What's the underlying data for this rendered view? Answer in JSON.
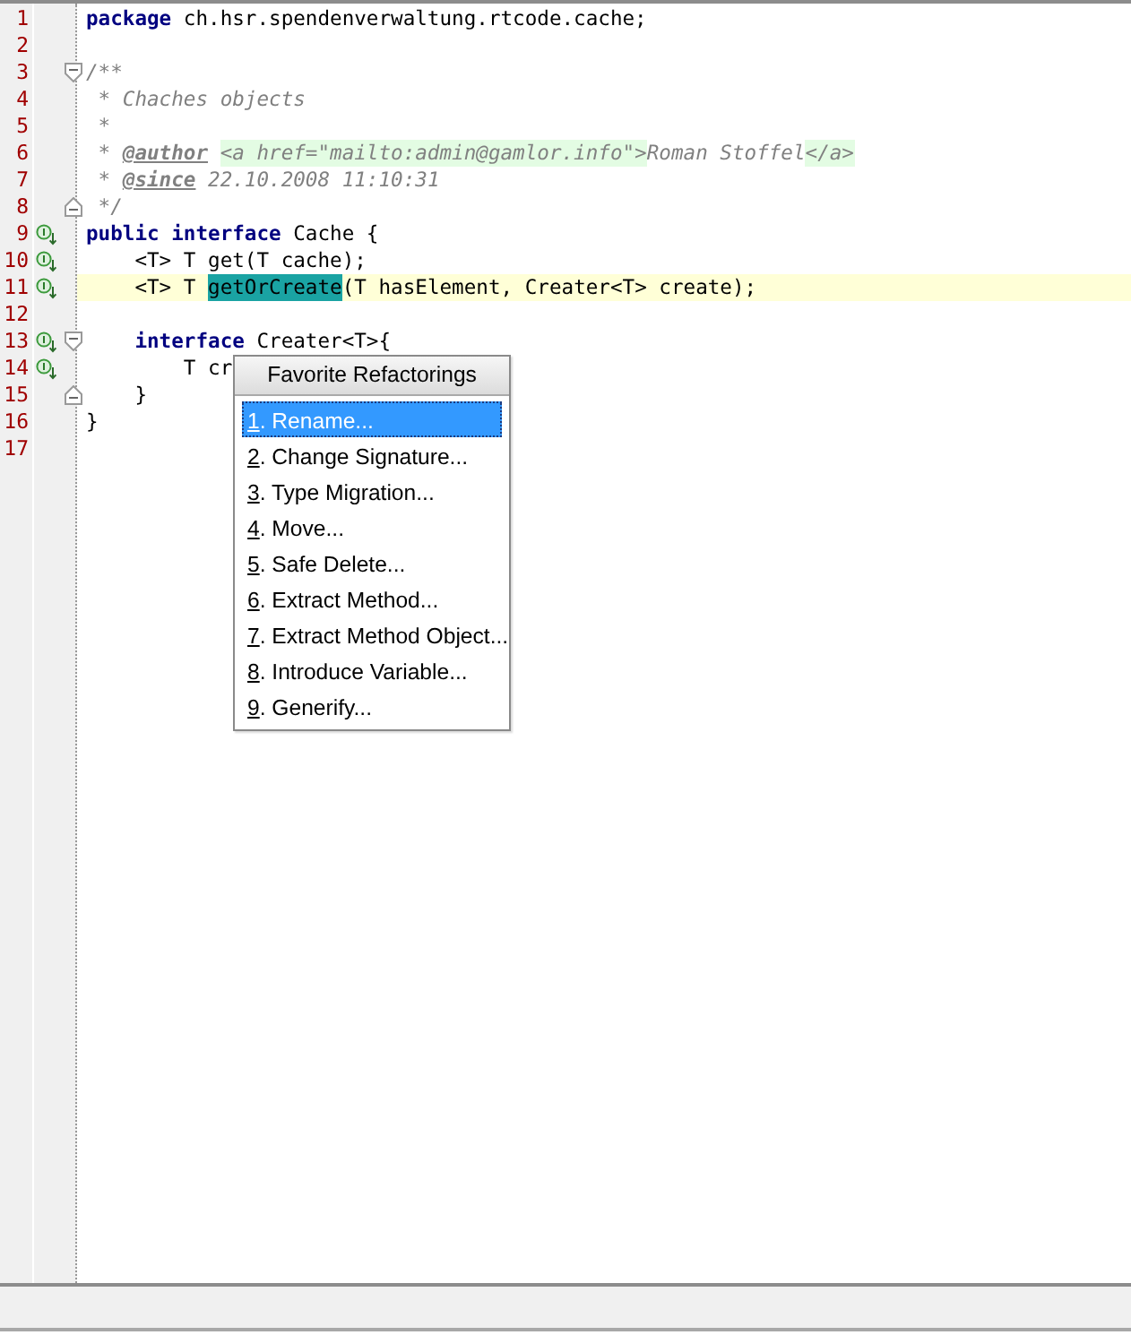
{
  "editor": {
    "lines": [
      {
        "number": "1",
        "implemented": false,
        "fold_start": false,
        "fold_end": false,
        "current": false,
        "segments": [
          {
            "kind": "keyword",
            "text": "package"
          },
          {
            "kind": "plain",
            "text": " ch.hsr.spendenverwaltung.rtcode.cache;"
          }
        ]
      },
      {
        "number": "2",
        "implemented": false,
        "fold_start": false,
        "fold_end": false,
        "current": false
      },
      {
        "number": "3",
        "implemented": false,
        "fold_start": true,
        "fold_end": false,
        "current": false,
        "segments": [
          {
            "kind": "comment",
            "text": "/**"
          }
        ]
      },
      {
        "number": "4",
        "implemented": false,
        "fold_start": false,
        "fold_end": false,
        "current": false,
        "segments": [
          {
            "kind": "comment",
            "text": " * Chaches objects"
          }
        ]
      },
      {
        "number": "5",
        "implemented": false,
        "fold_start": false,
        "fold_end": false,
        "current": false,
        "segments": [
          {
            "kind": "comment",
            "text": " *"
          }
        ]
      },
      {
        "number": "6",
        "implemented": false,
        "fold_start": false,
        "fold_end": false,
        "current": false,
        "segments": [
          {
            "kind": "comment",
            "text": " * "
          },
          {
            "kind": "doctag",
            "text": "@author"
          },
          {
            "kind": "html",
            "text": "<a href=\"mailto:admin@gamlor.info\">"
          },
          {
            "kind": "comment",
            "text": "Roman Stoffel"
          },
          {
            "kind": "html",
            "text": "</a>"
          }
        ]
      },
      {
        "number": "7",
        "implemented": false,
        "fold_start": false,
        "fold_end": false,
        "current": false,
        "segments": [
          {
            "kind": "comment",
            "text": " * "
          },
          {
            "kind": "doctag",
            "text": "@since"
          },
          {
            "kind": "comment",
            "text": " 22.10.2008 11:10:31"
          }
        ]
      },
      {
        "number": "8",
        "implemented": false,
        "fold_start": false,
        "fold_end": true,
        "current": false,
        "segments": [
          {
            "kind": "comment",
            "text": " */"
          }
        ]
      },
      {
        "number": "9",
        "implemented": true,
        "fold_start": false,
        "fold_end": false,
        "current": false,
        "segments": [
          {
            "kind": "keyword",
            "text": "public interface"
          },
          {
            "kind": "plain",
            "text": " Cache {"
          }
        ]
      },
      {
        "number": "10",
        "implemented": true,
        "fold_start": false,
        "fold_end": false,
        "current": false,
        "segments": [
          {
            "kind": "plain",
            "text": "    <T> T get(T cache);"
          }
        ]
      },
      {
        "number": "11",
        "implemented": true,
        "fold_start": false,
        "fold_end": false,
        "current": true,
        "segments": [
          {
            "kind": "plain",
            "text": "    <T> T "
          },
          {
            "kind": "highlight",
            "text": "getOrCreate"
          },
          {
            "kind": "plain",
            "text": "(T hasElement, Creater<T> create);"
          }
        ]
      },
      {
        "number": "12",
        "implemented": false,
        "fold_start": false,
        "fold_end": false,
        "current": false
      },
      {
        "number": "13",
        "implemented": true,
        "fold_start": true,
        "fold_end": false,
        "current": false,
        "segments": [
          {
            "kind": "keyword",
            "text": "    interface"
          },
          {
            "kind": "plain",
            "text": " Creater<T>{"
          }
        ]
      },
      {
        "number": "14",
        "implemented": true,
        "fold_start": false,
        "fold_end": false,
        "current": false,
        "segments": [
          {
            "kind": "plain",
            "text": "        T cr"
          }
        ]
      },
      {
        "number": "15",
        "implemented": false,
        "fold_start": false,
        "fold_end": true,
        "current": false,
        "segments": [
          {
            "kind": "plain",
            "text": "    }"
          }
        ]
      },
      {
        "number": "16",
        "implemented": false,
        "fold_start": false,
        "fold_end": false,
        "current": false,
        "segments": [
          {
            "kind": "plain",
            "text": "}"
          }
        ]
      },
      {
        "number": "17",
        "implemented": false,
        "fold_start": false,
        "fold_end": false,
        "current": false
      }
    ]
  },
  "popup": {
    "title": "Favorite Refactorings",
    "items": [
      {
        "key": "1",
        "label": ". Rename...",
        "selected": true
      },
      {
        "key": "2",
        "label": ". Change Signature...",
        "selected": false
      },
      {
        "key": "3",
        "label": ". Type Migration...",
        "selected": false
      },
      {
        "key": "4",
        "label": ". Move...",
        "selected": false
      },
      {
        "key": "5",
        "label": ". Safe Delete...",
        "selected": false
      },
      {
        "key": "6",
        "label": ". Extract Method...",
        "selected": false
      },
      {
        "key": "7",
        "label": ". Extract Method Object...",
        "selected": false
      },
      {
        "key": "8",
        "label": ". Introduce Variable...",
        "selected": false
      },
      {
        "key": "9",
        "label": ". Generify...",
        "selected": false
      }
    ]
  }
}
